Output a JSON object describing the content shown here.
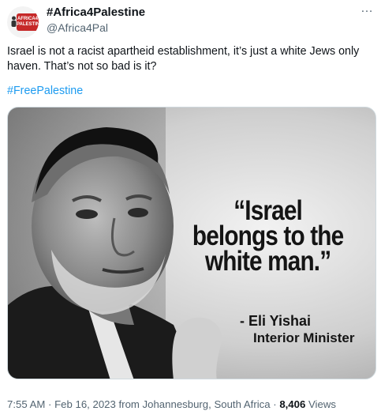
{
  "author": {
    "display_name": "#Africa4Palestine",
    "handle": "@Africa4Pal",
    "avatar_text": "AFRICA4 PALESTINE"
  },
  "tweet": {
    "text": "Israel is not a racist apartheid establishment, it’s just a white Jews only haven. That’s not so bad is it?",
    "hashtag": "#FreePalestine"
  },
  "media": {
    "quote": "“Israel belongs to the white man.”",
    "attribution_name": "- Eli Yishai",
    "attribution_title": "Interior Minister"
  },
  "meta": {
    "time": "7:55 AM",
    "separator": " · ",
    "date": "Feb 16, 2023 from Johannesburg, South Africa",
    "views_count": "8,406",
    "views_label": " Views"
  },
  "icons": {
    "more": "more-horizontal-icon"
  },
  "colors": {
    "link": "#1d9bf0",
    "secondary_text": "#536471",
    "primary_text": "#0f1419",
    "brand_red": "#c62828"
  }
}
